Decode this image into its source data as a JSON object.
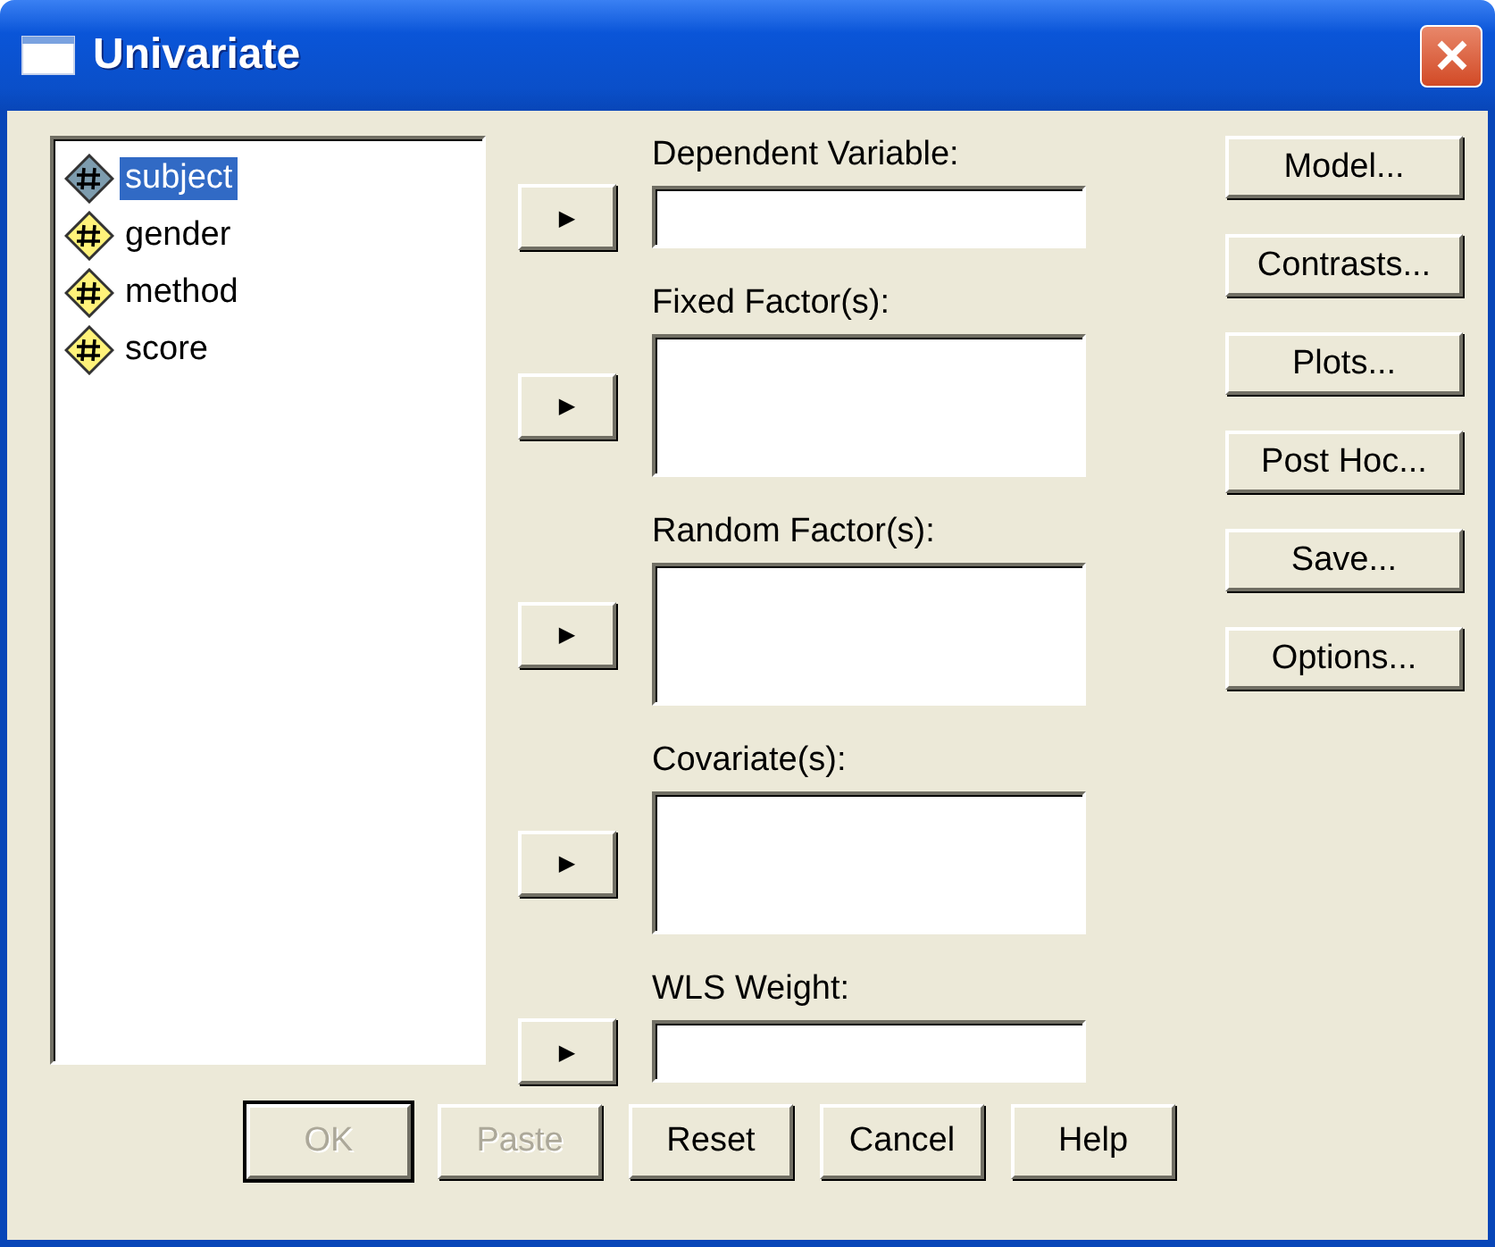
{
  "window": {
    "title": "Univariate"
  },
  "variables": [
    {
      "label": "subject",
      "selected": true
    },
    {
      "label": "gender",
      "selected": false
    },
    {
      "label": "method",
      "selected": false
    },
    {
      "label": "score",
      "selected": false
    }
  ],
  "targets": [
    {
      "label": "Dependent Variable:",
      "kind": "single"
    },
    {
      "label": "Fixed Factor(s):",
      "kind": "list"
    },
    {
      "label": "Random Factor(s):",
      "kind": "list"
    },
    {
      "label": "Covariate(s):",
      "kind": "list"
    },
    {
      "label": "WLS Weight:",
      "kind": "single"
    }
  ],
  "arrow_symbol": "▶",
  "side_buttons": [
    "Model...",
    "Contrasts...",
    "Plots...",
    "Post Hoc...",
    "Save...",
    "Options..."
  ],
  "bottom_buttons": [
    {
      "label": "OK",
      "disabled": true,
      "default": true
    },
    {
      "label": "Paste",
      "disabled": true,
      "default": false
    },
    {
      "label": "Reset",
      "disabled": false,
      "default": false
    },
    {
      "label": "Cancel",
      "disabled": false,
      "default": false
    },
    {
      "label": "Help",
      "disabled": false,
      "default": false
    }
  ]
}
